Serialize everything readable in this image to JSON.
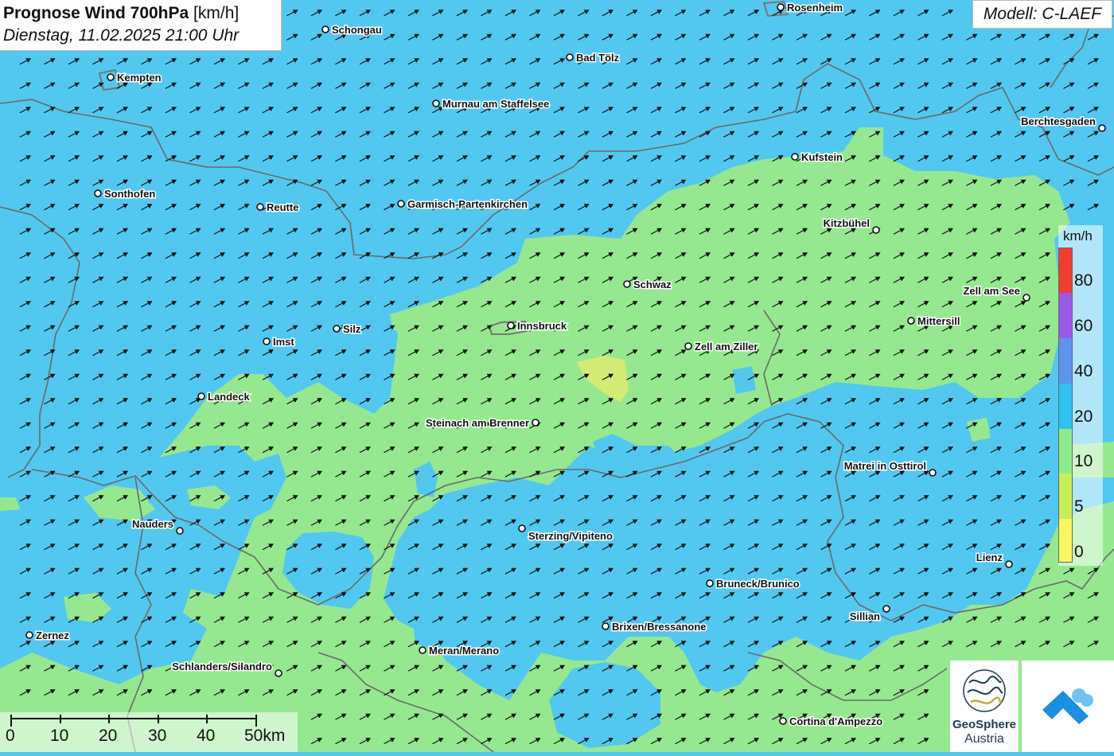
{
  "header": {
    "title_bold": "Prognose Wind 700hPa",
    "title_unit": "[km/h]",
    "datetime": "Dienstag, 11.02.2025 21:00 Uhr",
    "model": "Modell: C-LAEF"
  },
  "legend": {
    "unit": "km/h",
    "labels": [
      "80",
      "60",
      "40",
      "20",
      "10",
      "5",
      "0"
    ],
    "colors": [
      "#f23c2f",
      "#9a5ae8",
      "#5c94ee",
      "#2cc3f0",
      "#8eea8a",
      "#c8ee55",
      "#fbf65e"
    ]
  },
  "scale_bar": {
    "labels": [
      "0",
      "10",
      "20",
      "30",
      "40",
      "50km"
    ]
  },
  "colors": {
    "wind_20_40": "#52c8f0",
    "wind_10_20": "#95e88f",
    "wind_5_10": "#d2ec74",
    "border": "#6a6a6a"
  },
  "wind": {
    "direction": "south-west",
    "arrow_glyph": "➚"
  },
  "cities": [
    {
      "name": "Rosenheim"
    },
    {
      "name": "Schongau"
    },
    {
      "name": "Bad Tölz"
    },
    {
      "name": "Kempten"
    },
    {
      "name": "Murnau am Staffelsee"
    },
    {
      "name": "Berchtesgaden"
    },
    {
      "name": "Kufstein"
    },
    {
      "name": "Sonthofen"
    },
    {
      "name": "Reutte"
    },
    {
      "name": "Garmisch-Partenkirchen"
    },
    {
      "name": "Kitzbühel"
    },
    {
      "name": "Schwaz"
    },
    {
      "name": "Zell am See"
    },
    {
      "name": "Innsbruck"
    },
    {
      "name": "Silz"
    },
    {
      "name": "Mittersill"
    },
    {
      "name": "Imst"
    },
    {
      "name": "Zell am Ziller"
    },
    {
      "name": "Landeck"
    },
    {
      "name": "Steinach am Brenner"
    },
    {
      "name": "Matrei in Osttirol"
    },
    {
      "name": "Nauders"
    },
    {
      "name": "Sterzing/Vipiteno"
    },
    {
      "name": "Lienz"
    },
    {
      "name": "Bruneck/Brunico"
    },
    {
      "name": "Sillian"
    },
    {
      "name": "Brixen/Bressanone"
    },
    {
      "name": "Zernez"
    },
    {
      "name": "Meran/Merano"
    },
    {
      "name": "Schlanders/Silandro"
    },
    {
      "name": "Cortina d'Ampezzo"
    }
  ],
  "logos": {
    "geosphere_name": "GeoSphere",
    "geosphere_country": "Austria"
  }
}
